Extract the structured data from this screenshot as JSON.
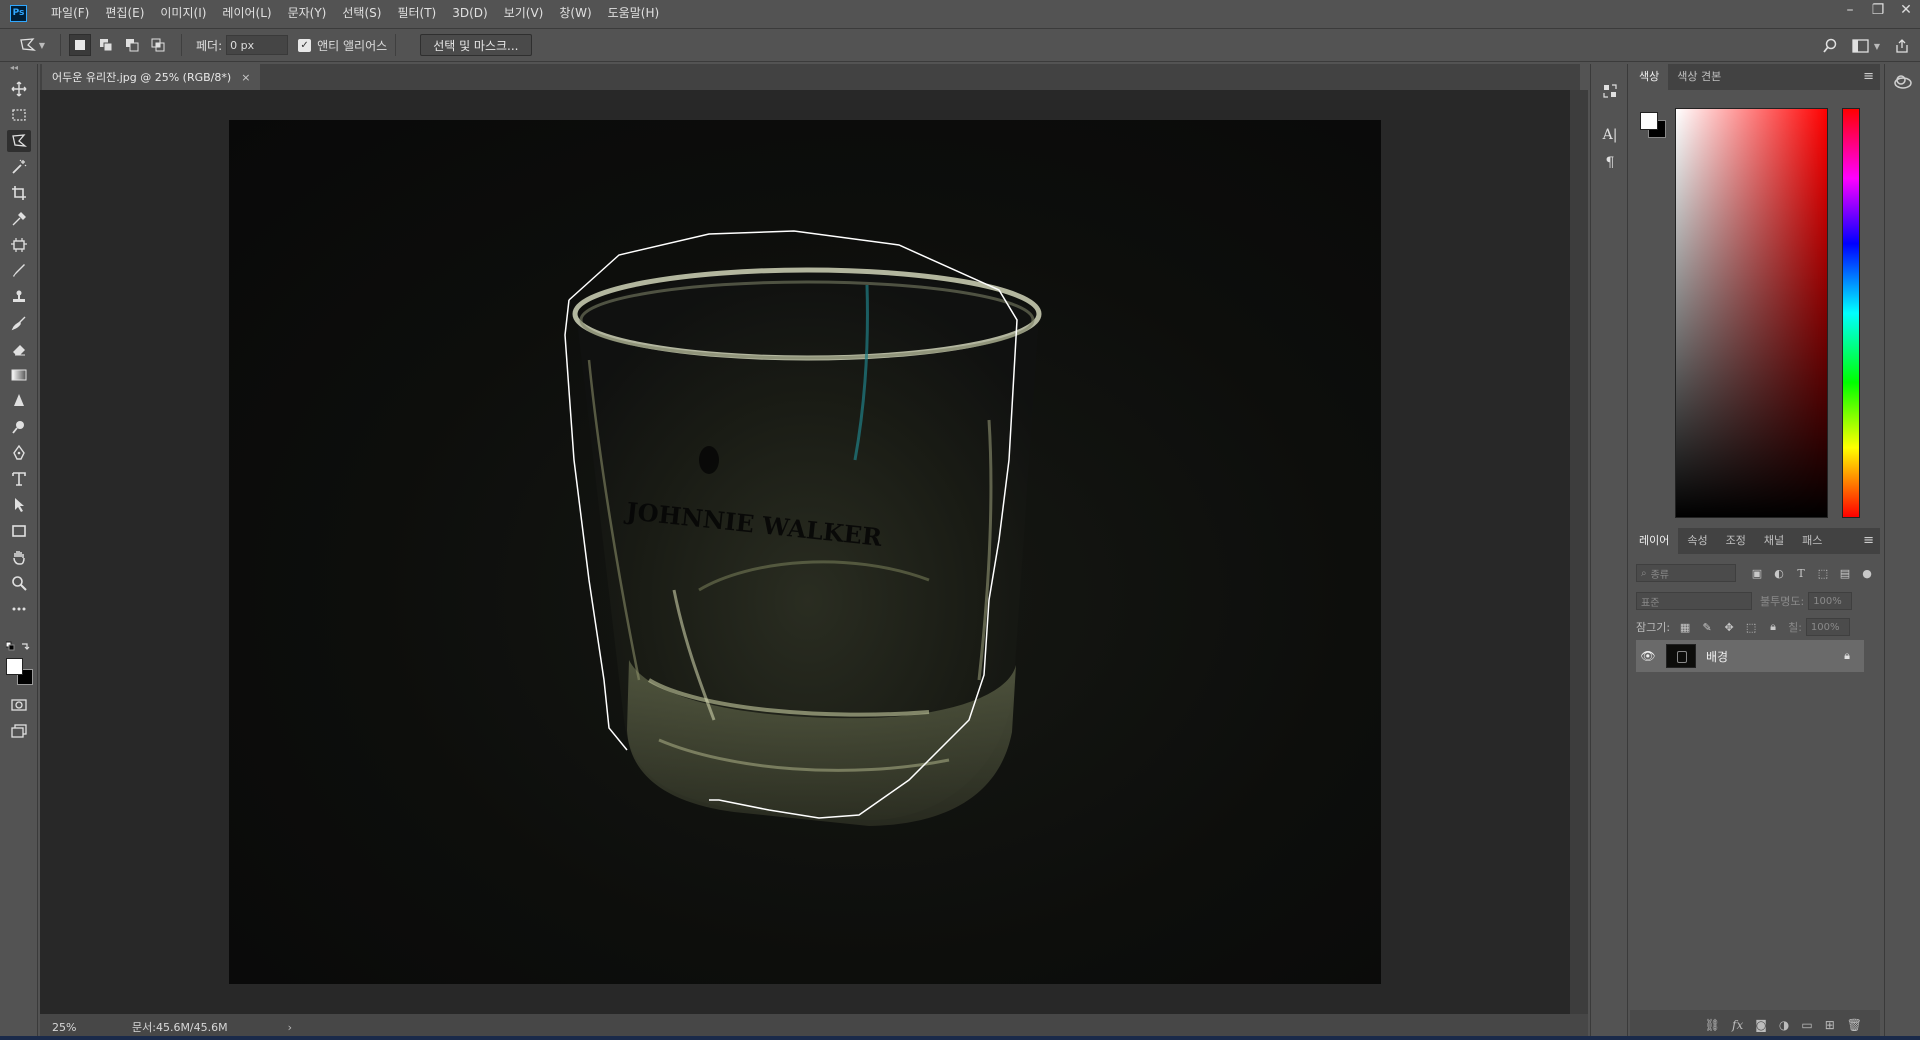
{
  "app": {
    "logo": "Ps",
    "window_controls": [
      "–",
      "❐",
      "✕"
    ]
  },
  "menu": [
    "파일(F)",
    "편집(E)",
    "이미지(I)",
    "레이어(L)",
    "문자(Y)",
    "선택(S)",
    "필터(T)",
    "3D(D)",
    "보기(V)",
    "창(W)",
    "도움말(H)"
  ],
  "options": {
    "feather_label": "페더:",
    "feather_value": "0 px",
    "antialias_label": "앤티 앨리어스",
    "antialias_checked": true,
    "select_mask_label": "선택 및 마스크..."
  },
  "document": {
    "tab_title": "어두운 유리잔.jpg @ 25% (RGB/8*)",
    "tab_close": "×",
    "zoom": "25%",
    "doc_size": "문서:45.6M/45.6M",
    "status_arrow": "›",
    "glass_text": "JOHNNIE WALKER"
  },
  "color_panel": {
    "tabs": [
      "색상",
      "색상 견본"
    ],
    "foreground": "#ffffff",
    "background": "#000000",
    "hue": "#ff0000"
  },
  "layers_panel": {
    "tabs": [
      "레이어",
      "속성",
      "조정",
      "채널",
      "패스"
    ],
    "filter_placeholder": "종류",
    "blend_mode": "표준",
    "opacity_label": "불투명도:",
    "opacity_value": "100%",
    "lock_label": "잠그기:",
    "fill_label": "칠:",
    "fill_value": "100%",
    "layers": [
      {
        "name": "배경",
        "visible": true,
        "locked": true
      }
    ]
  },
  "tool_icons": [
    "move-icon",
    "marquee-icon",
    "polygonal-lasso-icon",
    "magic-wand-icon",
    "crop-icon",
    "eyedropper-icon",
    "frame-icon",
    "brush-icon",
    "stamp-icon",
    "history-brush-icon",
    "eraser-icon",
    "gradient-icon",
    "blur-icon",
    "dodge-icon",
    "pen-icon",
    "type-icon",
    "path-select-icon",
    "rectangle-icon",
    "hand-icon",
    "zoom-icon",
    "more-icon"
  ]
}
